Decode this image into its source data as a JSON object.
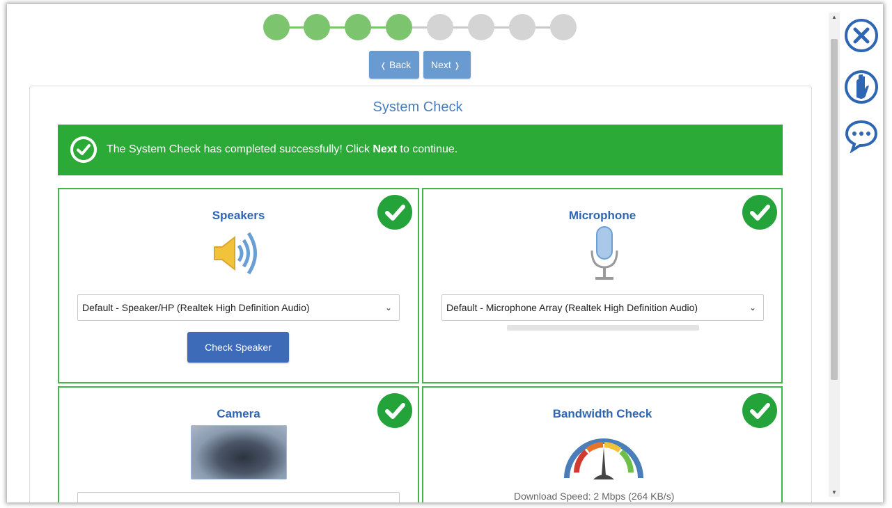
{
  "stepper": {
    "total_steps": 8,
    "completed_steps": 4
  },
  "nav": {
    "back_label": "Back",
    "next_label": "Next"
  },
  "title": "System Check",
  "banner": {
    "message_prefix": "The System Check has completed successfully! Click ",
    "message_bold": "Next",
    "message_suffix": " to continue."
  },
  "panels": {
    "speakers": {
      "title": "Speakers",
      "device": "Default - Speaker/HP (Realtek High Definition Audio)",
      "button": "Check Speaker",
      "status": "passed"
    },
    "microphone": {
      "title": "Microphone",
      "device": "Default - Microphone Array (Realtek High Definition Audio)",
      "status": "passed"
    },
    "camera": {
      "title": "Camera",
      "status": "passed"
    },
    "bandwidth": {
      "title": "Bandwidth Check",
      "status_text": "Download Speed: 2 Mbps (264 KB/s)",
      "status": "passed"
    }
  },
  "side_tools": [
    "close-icon",
    "raise-hand-icon",
    "chat-icon"
  ],
  "colors": {
    "success": "#2baa38",
    "accent": "#3d6bb8",
    "title": "#4a7ebb"
  }
}
